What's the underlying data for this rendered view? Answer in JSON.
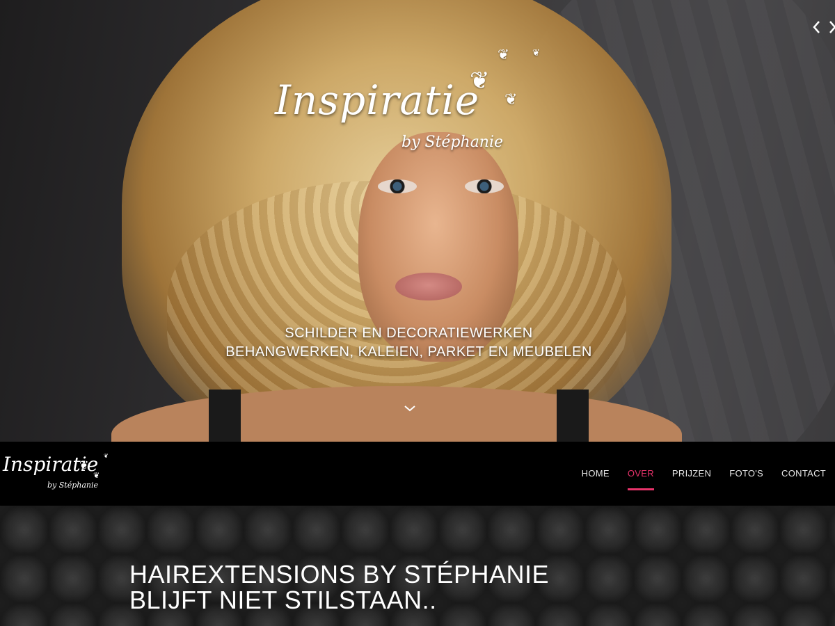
{
  "hero": {
    "logo": {
      "script": "Inspiratie",
      "by": "by Stéphanie"
    },
    "tagline_line1": "SCHILDER EN DECORATIEWERKEN",
    "tagline_line2": "BEHANGWERKEN, KALEIEN, PARKET EN MEUBELEN",
    "prev_icon": "‹",
    "next_icon": "›",
    "scroll_icon": "⌄"
  },
  "navbar": {
    "logo": {
      "script": "Inspiratie",
      "by": "by Stéphanie"
    },
    "items": [
      {
        "label": "HOME"
      },
      {
        "label": "OVER"
      },
      {
        "label": "PRIJZEN"
      },
      {
        "label": "FOTO'S"
      },
      {
        "label": "CONTACT"
      }
    ],
    "active": "OVER"
  },
  "content": {
    "heading_line1": "HAIREXTENSIONS BY STÉPHANIE",
    "heading_line2": "BLIJFT NIET STILSTAAN.."
  },
  "colors": {
    "accent": "#e8336b",
    "nav_bg": "#000000",
    "text": "#ffffff"
  }
}
